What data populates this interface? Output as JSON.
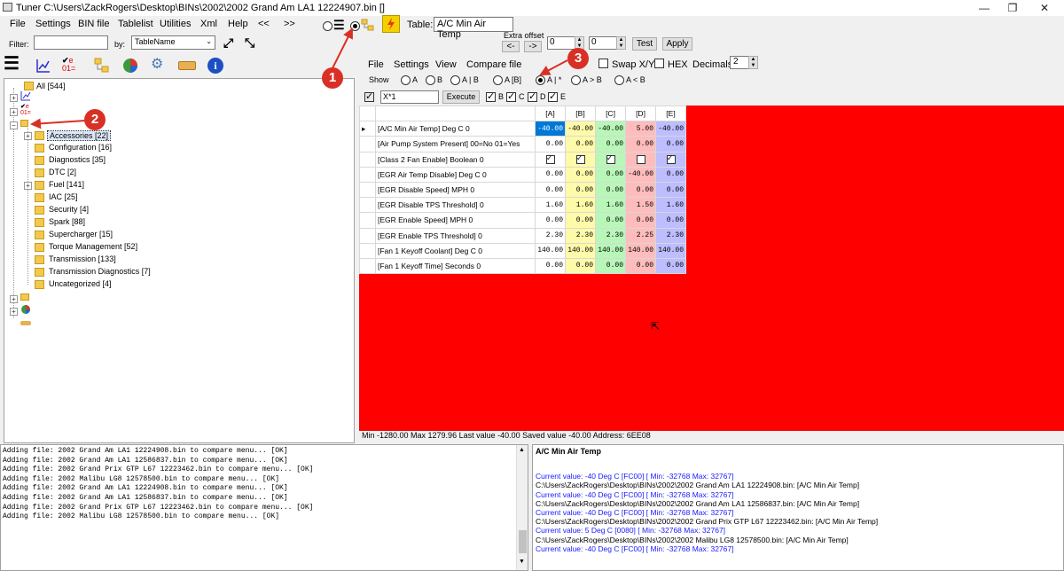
{
  "window": {
    "title": "Tuner C:\\Users\\ZackRogers\\Desktop\\BINs\\2002\\2002 Grand Am LA1 12224907.bin []",
    "minimize": "—",
    "maximize": "❐",
    "close": "✕"
  },
  "menu": [
    "File",
    "Settings",
    "BIN file",
    "Tablelist",
    "Utilities",
    "Xml",
    "Help",
    "<<",
    ">>"
  ],
  "toolbar": {
    "table_label": "Table:",
    "table_value": "A/C Min Air Temp",
    "extra_offset_label": "Extra offset",
    "offset_left": "<-",
    "offset_right": "->",
    "offset_value_1": "0",
    "offset_value_2": "0",
    "test_label": "Test",
    "apply_label": "Apply"
  },
  "filter": {
    "label": "Filter:",
    "value": "",
    "by_label": "by:",
    "by_value": "TableName"
  },
  "editor_menu": [
    "File",
    "Settings",
    "View",
    "Compare file"
  ],
  "editor_options": {
    "swap_label": "Swap X/Y",
    "hex_label": "HEX",
    "decimals_label": "Decimals:",
    "decimals_value": "2"
  },
  "show": {
    "label": "Show",
    "options": [
      "A",
      "B",
      "A | B",
      "A [B]",
      "A | *",
      "A > B",
      "A < B"
    ],
    "selected": "A | *"
  },
  "formula": {
    "value": "X*1",
    "execute_label": "Execute",
    "checks": [
      "B",
      "C",
      "D",
      "E"
    ]
  },
  "tree": {
    "root": "All [544]",
    "categories": [
      "Accessories [22]",
      "Configuration [16]",
      "Diagnostics [35]",
      "DTC [2]",
      "Fuel [141]",
      "IAC [25]",
      "Security [4]",
      "Spark [88]",
      "Supercharger [15]",
      "Torque Management [52]",
      "Transmission [133]",
      "Transmission Diagnostics [7]",
      "Uncategorized [4]"
    ]
  },
  "grid": {
    "columns": [
      "[A]",
      "[B]",
      "[C]",
      "[D]",
      "[E]"
    ],
    "rows": [
      {
        "name": "[A/C Min Air Temp] Deg C 0",
        "values": [
          "-40.00",
          "-40.00",
          "-40.00",
          "5.00",
          "-40.00"
        ]
      },
      {
        "name": "[Air Pump System Present] 00=No 01=Yes",
        "values": [
          "0.00",
          "0.00",
          "0.00",
          "0.00",
          "0.00"
        ]
      },
      {
        "name": "[Class 2 Fan Enable] Boolean 0",
        "values": [
          "on",
          "on",
          "on",
          "off",
          "on"
        ]
      },
      {
        "name": "[EGR Air Temp Disable] Deg C 0",
        "values": [
          "0.00",
          "0.00",
          "0.00",
          "-40.00",
          "0.00"
        ]
      },
      {
        "name": "[EGR Disable Speed] MPH 0",
        "values": [
          "0.00",
          "0.00",
          "0.00",
          "0.00",
          "0.00"
        ]
      },
      {
        "name": "[EGR Disable TPS Threshold]  0",
        "values": [
          "1.60",
          "1.60",
          "1.60",
          "1.50",
          "1.60"
        ]
      },
      {
        "name": "[EGR Enable Speed] MPH 0",
        "values": [
          "0.00",
          "0.00",
          "0.00",
          "0.00",
          "0.00"
        ]
      },
      {
        "name": "[EGR Enable TPS Threshold]  0",
        "values": [
          "2.30",
          "2.30",
          "2.30",
          "2.25",
          "2.30"
        ]
      },
      {
        "name": "[Fan 1 Keyoff Coolant] Deg C 0",
        "values": [
          "140.00",
          "140.00",
          "140.00",
          "140.00",
          "140.00"
        ]
      },
      {
        "name": "[Fan 1 Keyoff Time] Seconds 0",
        "values": [
          "0.00",
          "0.00",
          "0.00",
          "0.00",
          "0.00"
        ]
      }
    ],
    "status": "Min -1280.00 Max 1279.96 Last value -40.00 Saved value -40.00 Address: 6EE08"
  },
  "log_left": [
    "Adding file: 2002 Grand Am LA1 12224908.bin to compare menu... [OK]",
    "Adding file: 2002 Grand Am LA1 12586837.bin to compare menu... [OK]",
    "Adding file: 2002 Grand Prix GTP L67 12223462.bin to compare menu... [OK]",
    "Adding file: 2002 Malibu LG8 12578500.bin to compare menu... [OK]",
    "Adding file: 2002 Grand Am LA1 12224908.bin to compare menu... [OK]",
    "Adding file: 2002 Grand Am LA1 12586837.bin to compare menu... [OK]",
    "Adding file: 2002 Grand Prix GTP L67 12223462.bin to compare menu... [OK]",
    "Adding file: 2002 Malibu LG8 12578500.bin to compare menu... [OK]"
  ],
  "log_right": {
    "title": "A/C Min Air Temp",
    "lines": [
      {
        "text": "Current value: -40 Deg C [FC00] [ Min: -32768 Max: 32767]",
        "color": "blue"
      },
      {
        "text": "C:\\Users\\ZackRogers\\Desktop\\BINs\\2002\\2002 Grand Am LA1 12224908.bin: [A/C Min Air Temp]",
        "color": "black"
      },
      {
        "text": "Current value: -40 Deg C [FC00] [ Min: -32768 Max: 32767]",
        "color": "blue"
      },
      {
        "text": "C:\\Users\\ZackRogers\\Desktop\\BINs\\2002\\2002 Grand Am LA1 12586837.bin: [A/C Min Air Temp]",
        "color": "black"
      },
      {
        "text": "Current value: -40 Deg C [FC00] [ Min: -32768 Max: 32767]",
        "color": "blue"
      },
      {
        "text": "C:\\Users\\ZackRogers\\Desktop\\BINs\\2002\\2002 Grand Prix GTP L67 12223462.bin: [A/C Min Air Temp]",
        "color": "black"
      },
      {
        "text": "Current value: 5 Deg C [0080] [ Min: -32768 Max: 32767]",
        "color": "blue"
      },
      {
        "text": "C:\\Users\\ZackRogers\\Desktop\\BINs\\2002\\2002 Malibu LG8 12578500.bin: [A/C Min Air Temp]",
        "color": "black"
      },
      {
        "text": "Current value: -40 Deg C [FC00] [ Min: -32768 Max: 32767]",
        "color": "blue"
      }
    ]
  },
  "callouts": [
    "1",
    "2",
    "3"
  ],
  "colors": {
    "grid_background": "#ff0000",
    "col_A": "#ffffff",
    "col_B": "#fffaa9",
    "col_C": "#b8f7b8",
    "col_D": "#ffbcbc",
    "col_E": "#bdbdff",
    "selected_cell": "#0078d7",
    "callout": "#d93025"
  }
}
